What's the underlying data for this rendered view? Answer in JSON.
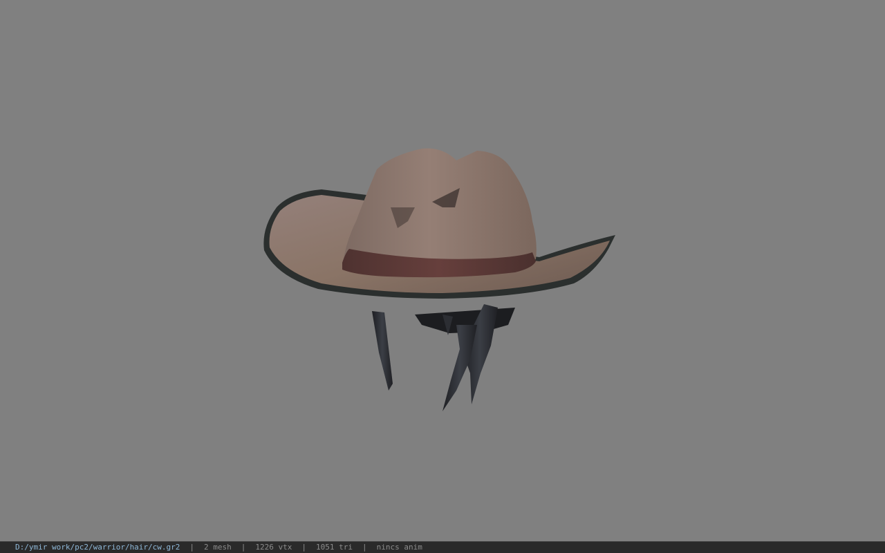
{
  "viewer": {
    "background_color": "#808080",
    "model_name": "cowboy-hat-with-hair"
  },
  "status_bar": {
    "file_path": "D:/ymir work/pc2/warrior/hair/cw.gr2",
    "separator": "|",
    "mesh_count": "2 mesh",
    "vertex_count": "1226 vtx",
    "triangle_count": "1051 tri",
    "anim_status": "nincs anim"
  },
  "colors": {
    "hat_felt": "#8a7466",
    "hat_band": "#5a3a37",
    "brim_edge": "#2b2f2e",
    "hair": "#2a2c30",
    "path_text": "#8fb8d8",
    "stat_text": "#8c8c8c"
  }
}
